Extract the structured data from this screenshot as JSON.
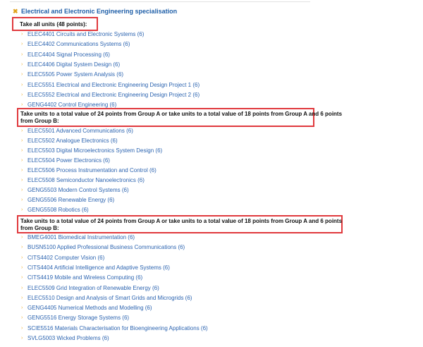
{
  "spec_title": "Electrical and Electronic Engineering specialisation",
  "icons": {
    "close": "x-icon",
    "bullet": "chevron-right-icon"
  },
  "colors": {
    "link": "#2c64b0",
    "highlight_box": "#e0393d",
    "bullet": "#f0b23a"
  },
  "group1": {
    "heading": "Take all units (48 points):",
    "units": [
      "ELEC4401 Circuits and Electronic Systems (6)",
      "ELEC4402 Communications Systems (6)",
      "ELEC4404 Signal Processing (6)",
      "ELEC4406 Digital System Design (6)",
      "ELEC5505 Power System Analysis (6)",
      "ELEC5551 Electrical and Electronic Engineering Design Project 1 (6)",
      "ELEC5552 Electrical and Electronic Engineering Design Project 2 (6)",
      "GENG4402 Control Engineering (6)"
    ]
  },
  "group2": {
    "heading_line1": "Take units to a total value of 24 points from Group A or take units to a total value of 18 points from Group A and 6 points",
    "heading_line2": "from Group B:",
    "units": [
      "ELEC5501 Advanced Communications (6)",
      "ELEC5502 Analogue Electronics (6)",
      "ELEC5503 Digital Microelectronics System Design (6)",
      "ELEC5504 Power Electronics (6)",
      "ELEC5506 Process Instrumentation and Control (6)",
      "ELEC5508 Semiconductor Nanoelectronics (6)",
      "GENG5503 Modern Control Systems (6)",
      "GENG5506 Renewable Energy (6)",
      "GENG5508 Robotics (6)"
    ]
  },
  "group3": {
    "heading_line1": "Take units to a total value of 24 points from Group A or take units to a total value of 18 points from Group A and 6 points",
    "heading_line2": "from Group B:",
    "units": [
      "BMEG4001 Biomedical Instrumentation (6)",
      "BUSN5100 Applied Professional Business Communications (6)",
      "CITS4402 Computer Vision (6)",
      "CITS4404 Artificial Intelligence and Adaptive Systems (6)",
      "CITS4419 Mobile and Wireless Computing (6)",
      "ELEC5509 Grid Integration of Renewable Energy (6)",
      "ELEC5510 Design and Analysis of Smart Grids and Microgrids (6)",
      "GENG4405 Numerical Methods and Modelling (6)",
      "GENG5516 Energy Storage Systems (6)",
      "SCIE5516 Materials Characterisation for Bioengineering Applications (6)",
      "SVLG5003 Wicked Problems (6)"
    ]
  }
}
